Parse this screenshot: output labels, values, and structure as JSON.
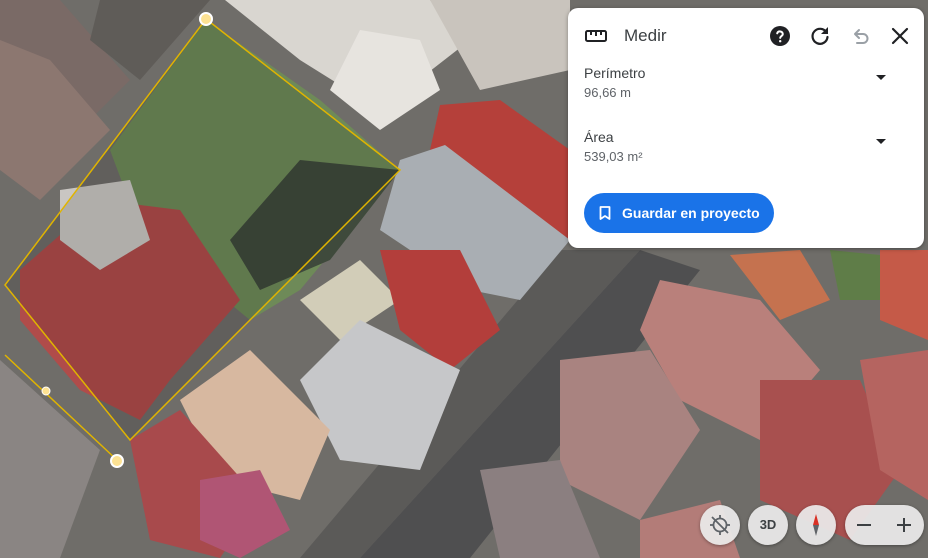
{
  "panel": {
    "title": "Medir",
    "rows": [
      {
        "label": "Perímetro",
        "value": "96,66 m"
      },
      {
        "label": "Área",
        "value": "539,03 m²"
      }
    ],
    "save_label": "Guardar en proyecto"
  },
  "controls": {
    "view3d_label": "3D"
  },
  "colors": {
    "accent": "#1a73e8",
    "measure_vertex": "#fde293",
    "measure_line": "#e0b400"
  },
  "icons": [
    "ruler-icon",
    "help-icon",
    "refresh-icon",
    "undo-icon",
    "close-icon",
    "bookmark-icon",
    "location-disabled-icon",
    "compass-icon",
    "zoom-out-icon",
    "zoom-in-icon"
  ]
}
